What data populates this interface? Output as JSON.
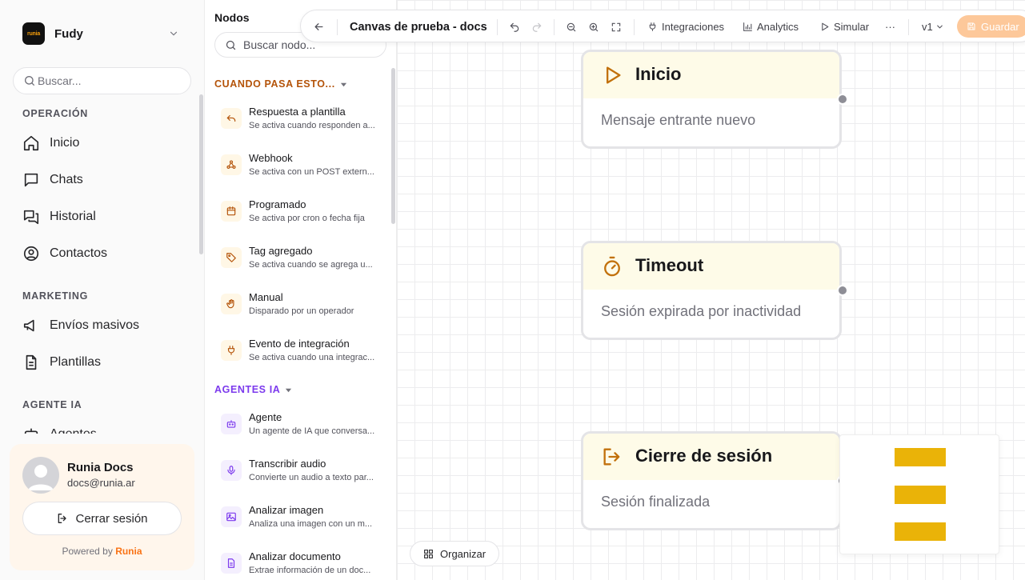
{
  "sidebar": {
    "workspace": {
      "logo_text": "runia",
      "name": "Fudy"
    },
    "search_placeholder": "Buscar...",
    "sections": [
      {
        "title": "OPERACIÓN",
        "items": [
          {
            "label": "Inicio",
            "icon": "home-icon"
          },
          {
            "label": "Chats",
            "icon": "chat-icon"
          },
          {
            "label": "Historial",
            "icon": "history-icon"
          },
          {
            "label": "Contactos",
            "icon": "contacts-icon"
          }
        ]
      },
      {
        "title": "MARKETING",
        "items": [
          {
            "label": "Envíos masivos",
            "icon": "megaphone-icon"
          },
          {
            "label": "Plantillas",
            "icon": "document-icon"
          }
        ]
      },
      {
        "title": "AGENTE IA",
        "items": [
          {
            "label": "Agentes",
            "icon": "bot-icon"
          }
        ]
      }
    ],
    "user": {
      "name": "Runia Docs",
      "email": "docs@runia.ar",
      "logout_label": "Cerrar sesión"
    },
    "powered": {
      "prefix": "Powered by",
      "brand": "Runia"
    }
  },
  "panel": {
    "title": "Nodos",
    "search_placeholder": "Buscar nodo...",
    "categories": [
      {
        "title": "CUANDO PASA ESTO...",
        "items": [
          {
            "name": "Respuesta a plantilla",
            "desc": "Se activa cuando responden a...",
            "icon": "reply-icon"
          },
          {
            "name": "Webhook",
            "desc": "Se activa con un POST extern...",
            "icon": "webhook-icon"
          },
          {
            "name": "Programado",
            "desc": "Se activa por cron o fecha fija",
            "icon": "calendar-icon"
          },
          {
            "name": "Tag agregado",
            "desc": "Se activa cuando se agrega u...",
            "icon": "tag-icon"
          },
          {
            "name": "Manual",
            "desc": "Disparado por un operador",
            "icon": "hand-icon"
          },
          {
            "name": "Evento de integración",
            "desc": "Se activa cuando una integrac...",
            "icon": "plug-icon"
          }
        ]
      },
      {
        "title": "AGENTES IA",
        "items": [
          {
            "name": "Agente",
            "desc": "Un agente de IA que conversa...",
            "icon": "bot-icon"
          },
          {
            "name": "Transcribir audio",
            "desc": "Convierte un audio a texto par...",
            "icon": "mic-icon"
          },
          {
            "name": "Analizar imagen",
            "desc": "Analiza una imagen con un m...",
            "icon": "image-icon"
          },
          {
            "name": "Analizar documento",
            "desc": "Extrae información de un doc...",
            "icon": "file-icon"
          }
        ]
      }
    ]
  },
  "toolbar": {
    "title": "Canvas de prueba - docs",
    "integrations": "Integraciones",
    "analytics": "Analytics",
    "simulate": "Simular",
    "more": "···",
    "version": "v1",
    "save": "Guardar"
  },
  "canvas": {
    "nodes": [
      {
        "title": "Inicio",
        "subtitle": "Mensaje entrante nuevo",
        "icon": "play-icon"
      },
      {
        "title": "Timeout",
        "subtitle": "Sesión expirada por inactividad",
        "icon": "stopwatch-icon"
      },
      {
        "title": "Cierre de sesión",
        "subtitle": "Sesión finalizada",
        "icon": "logout-icon"
      }
    ],
    "organize_label": "Organizar"
  },
  "colors": {
    "accent_orange": "#f97316",
    "trigger_category": "#b45309",
    "ai_category": "#7c3aed",
    "node_header_bg": "#fefbe8",
    "node_icon": "#c2710c",
    "popover_bar": "#eab308",
    "save_button": "#fdc89a"
  }
}
